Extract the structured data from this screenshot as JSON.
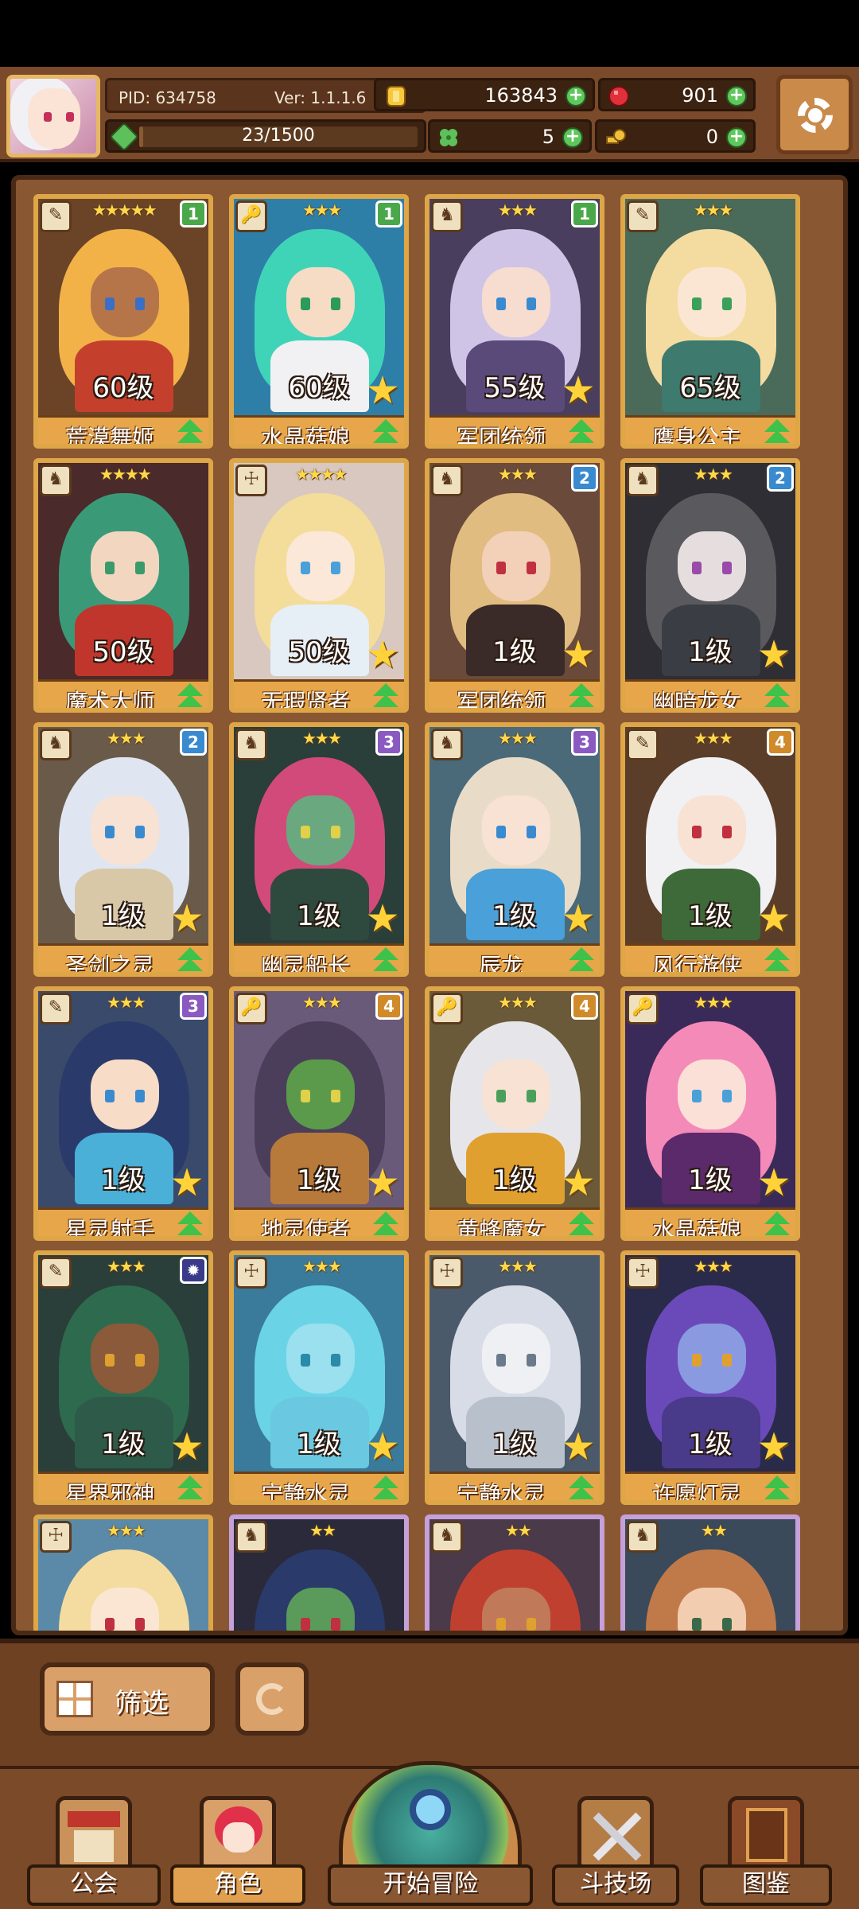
{
  "header": {
    "pid": "PID: 634758",
    "version": "Ver: 1.1.1.6",
    "xp_text": "23/1500",
    "xp_fraction": 0.0153,
    "gold": "163843",
    "rubies": "901",
    "clover": "5",
    "keys": "0"
  },
  "cards": [
    {
      "name": "荒漠舞姬",
      "level": "60级",
      "stars": "★★★★★",
      "rank": "1",
      "rank_color": "#4aa84a",
      "role": "✎",
      "upstar": false,
      "frame": "gold",
      "hair": "#f2b248",
      "skin": "#b67548",
      "body": "#c4402c",
      "eye": "#3a6fc8",
      "bg": "#6b4428"
    },
    {
      "name": "水晶菇娘",
      "level": "60级",
      "stars": "★★★",
      "rank": "1",
      "rank_color": "#4aa84a",
      "role": "🔑",
      "upstar": true,
      "frame": "gold",
      "hair": "#3fd4b8",
      "skin": "#f6dcc4",
      "body": "#f1f1f4",
      "eye": "#2c9a5a",
      "bg": "#2e7fa8"
    },
    {
      "name": "军团统领",
      "level": "55级",
      "stars": "★★★",
      "rank": "1",
      "rank_color": "#4aa84a",
      "role": "♞",
      "upstar": true,
      "frame": "gold",
      "hair": "#cfc4e6",
      "skin": "#f7dcd0",
      "body": "#5a4a7a",
      "eye": "#3a8ad0",
      "bg": "#4a3e5e"
    },
    {
      "name": "鹰身公主",
      "level": "65级",
      "stars": "★★★",
      "rank": "",
      "rank_color": "",
      "role": "✎",
      "upstar": false,
      "frame": "gold",
      "hair": "#f4dba0",
      "skin": "#fbe6d4",
      "body": "#3e7a6e",
      "eye": "#3aa05a",
      "bg": "#4a6a5a"
    },
    {
      "name": "魔术大师",
      "level": "50级",
      "stars": "★★★★",
      "rank": "",
      "rank_color": "",
      "role": "♞",
      "upstar": false,
      "frame": "gold",
      "hair": "#3a9a78",
      "skin": "#f3d6c0",
      "body": "#c0362c",
      "eye": "#3a9a6a",
      "bg": "#4a2a2a"
    },
    {
      "name": "无瑕贤者",
      "level": "50级",
      "stars": "★★★★",
      "rank": "",
      "rank_color": "",
      "role": "☩",
      "upstar": true,
      "frame": "gold",
      "hair": "#f4dc9a",
      "skin": "#fbe8d8",
      "body": "#e6eef6",
      "eye": "#4aa0d8",
      "bg": "#d8c8c0"
    },
    {
      "name": "军团统领",
      "level": "1级",
      "stars": "★★★",
      "rank": "2",
      "rank_color": "#3a8ad0",
      "role": "♞",
      "upstar": true,
      "frame": "gold",
      "hair": "#e0bc80",
      "skin": "#f3d0b8",
      "body": "#3a2a28",
      "eye": "#c03040",
      "bg": "#6a4a3a"
    },
    {
      "name": "幽暗龙女",
      "level": "1级",
      "stars": "★★★",
      "rank": "2",
      "rank_color": "#3a8ad0",
      "role": "♞",
      "upstar": true,
      "frame": "gold",
      "hair": "#5a5a5e",
      "skin": "#e6dede",
      "body": "#3a3e44",
      "eye": "#9a4aa8",
      "bg": "#2e2e34"
    },
    {
      "name": "圣剑之灵",
      "level": "1级",
      "stars": "★★★",
      "rank": "2",
      "rank_color": "#3a8ad0",
      "role": "♞",
      "upstar": true,
      "frame": "gold",
      "hair": "#dfe6f2",
      "skin": "#f7e2d4",
      "body": "#d8c8a8",
      "eye": "#3a8ad0",
      "bg": "#6a5a4a"
    },
    {
      "name": "幽灵船长",
      "level": "1级",
      "stars": "★★★",
      "rank": "3",
      "rank_color": "#8a5ac0",
      "role": "♞",
      "upstar": true,
      "frame": "gold",
      "hair": "#d24a7a",
      "skin": "#6aa880",
      "body": "#2e4a3e",
      "eye": "#e0d04a",
      "bg": "#2a3e3a"
    },
    {
      "name": "辰龙",
      "level": "1级",
      "stars": "★★★",
      "rank": "3",
      "rank_color": "#8a5ac0",
      "role": "♞",
      "upstar": true,
      "frame": "gold",
      "hair": "#e8dcc8",
      "skin": "#f7e2d4",
      "body": "#4aa0d8",
      "eye": "#3a8ad0",
      "bg": "#4a6a7a"
    },
    {
      "name": "风行游侠",
      "level": "1级",
      "stars": "★★★",
      "rank": "4",
      "rank_color": "#d08a2a",
      "role": "✎",
      "upstar": true,
      "frame": "gold",
      "hair": "#f1f1f4",
      "skin": "#f7e2d4",
      "body": "#3e6a3a",
      "eye": "#c03040",
      "bg": "#5a3e2a"
    },
    {
      "name": "星灵射手",
      "level": "1级",
      "stars": "★★★",
      "rank": "3",
      "rank_color": "#8a5ac0",
      "role": "✎",
      "upstar": true,
      "frame": "gold",
      "hair": "#2a3a6a",
      "skin": "#f7dcc8",
      "body": "#4ab0d8",
      "eye": "#3a8ad0",
      "bg": "#3a4a6a"
    },
    {
      "name": "地灵使者",
      "level": "1级",
      "stars": "★★★",
      "rank": "4",
      "rank_color": "#d08a2a",
      "role": "🔑",
      "upstar": true,
      "frame": "gold",
      "hair": "#4a3e5a",
      "skin": "#5a9a4a",
      "body": "#b87a3a",
      "eye": "#e0d04a",
      "bg": "#6a5a7a"
    },
    {
      "name": "黄蜂魔女",
      "level": "1级",
      "stars": "★★★",
      "rank": "4",
      "rank_color": "#d08a2a",
      "role": "🔑",
      "upstar": true,
      "frame": "gold",
      "hair": "#e6e6ea",
      "skin": "#f7e2d4",
      "body": "#e0a030",
      "eye": "#4aa05a",
      "bg": "#6a5a3a"
    },
    {
      "name": "水晶菇娘",
      "level": "1级",
      "stars": "★★★",
      "rank": "",
      "rank_color": "",
      "role": "🔑",
      "upstar": true,
      "frame": "gold",
      "hair": "#f48ab8",
      "skin": "#fbe0d8",
      "body": "#5a2a6a",
      "eye": "#4aa0d8",
      "bg": "#3a2a5a"
    },
    {
      "name": "星界邪神",
      "level": "1级",
      "stars": "★★★",
      "rank": "✹",
      "rank_color": "#3a3a8a",
      "role": "✎",
      "upstar": true,
      "frame": "gold",
      "hair": "#2e6a4e",
      "skin": "#8a5a3a",
      "body": "#2e5a4a",
      "eye": "#e0a030",
      "bg": "#2a3e3a"
    },
    {
      "name": "宁静水灵",
      "level": "1级",
      "stars": "★★★",
      "rank": "",
      "rank_color": "",
      "role": "☩",
      "upstar": true,
      "frame": "gold",
      "hair": "#6ad4e6",
      "skin": "#9ae0ee",
      "body": "#6ac8e0",
      "eye": "#2a8aa8",
      "bg": "#3a7a9a"
    },
    {
      "name": "宁静水灵",
      "level": "1级",
      "stars": "★★★",
      "rank": "",
      "rank_color": "",
      "role": "☩",
      "upstar": true,
      "frame": "gold",
      "hair": "#d8dce6",
      "skin": "#eef0f4",
      "body": "#b8c0cc",
      "eye": "#6a7a8a",
      "bg": "#4a5a6a"
    },
    {
      "name": "许愿灯灵",
      "level": "1级",
      "stars": "★★★",
      "rank": "",
      "rank_color": "",
      "role": "☩",
      "upstar": true,
      "frame": "gold",
      "hair": "#6a4ab8",
      "skin": "#8a9ae0",
      "body": "#4a3a8a",
      "eye": "#e0a030",
      "bg": "#2a2a4a"
    },
    {
      "name": "",
      "level": "",
      "stars": "★★★",
      "rank": "",
      "rank_color": "",
      "role": "☩",
      "upstar": false,
      "frame": "gold",
      "hair": "#f4dca0",
      "skin": "#fbe6d4",
      "body": "#e0c890",
      "eye": "#c03040",
      "bg": "#5a8aa8"
    },
    {
      "name": "",
      "level": "",
      "stars": "★★",
      "rank": "",
      "rank_color": "",
      "role": "♞",
      "upstar": false,
      "frame": "purple",
      "hair": "#2a3a6a",
      "skin": "#5a9a5a",
      "body": "#2a2a4a",
      "eye": "#c03040",
      "bg": "#2a2a3a"
    },
    {
      "name": "",
      "level": "",
      "stars": "★★",
      "rank": "",
      "rank_color": "",
      "role": "♞",
      "upstar": false,
      "frame": "purple",
      "hair": "#c04030",
      "skin": "#c07a5a",
      "body": "#5a2a2a",
      "eye": "#e0a030",
      "bg": "#4a3a4a"
    },
    {
      "name": "",
      "level": "",
      "stars": "★★",
      "rank": "",
      "rank_color": "",
      "role": "♞",
      "upstar": false,
      "frame": "purple",
      "hair": "#c07a4a",
      "skin": "#f3cdb0",
      "body": "#8a5a3a",
      "eye": "#3a6a4a",
      "bg": "#3a4a5a"
    }
  ],
  "toolbar": {
    "filter_label": "筛选"
  },
  "nav": {
    "guild": "公会",
    "characters": "角色",
    "adventure": "开始冒险",
    "arena": "斗技场",
    "codex": "图鉴"
  },
  "colors": {
    "gold_frame": "#dea646",
    "name_bar": "#e7a64a",
    "plus_green": "#5fc75c",
    "upgrade_arrow": "#3ec24a",
    "panel_brown": "#7a4a2a"
  },
  "icons": {
    "gold": "gold-coin-icon",
    "ruby": "ruby-icon",
    "clover": "clover-icon",
    "key": "key-icon",
    "settings": "gear-icon"
  }
}
